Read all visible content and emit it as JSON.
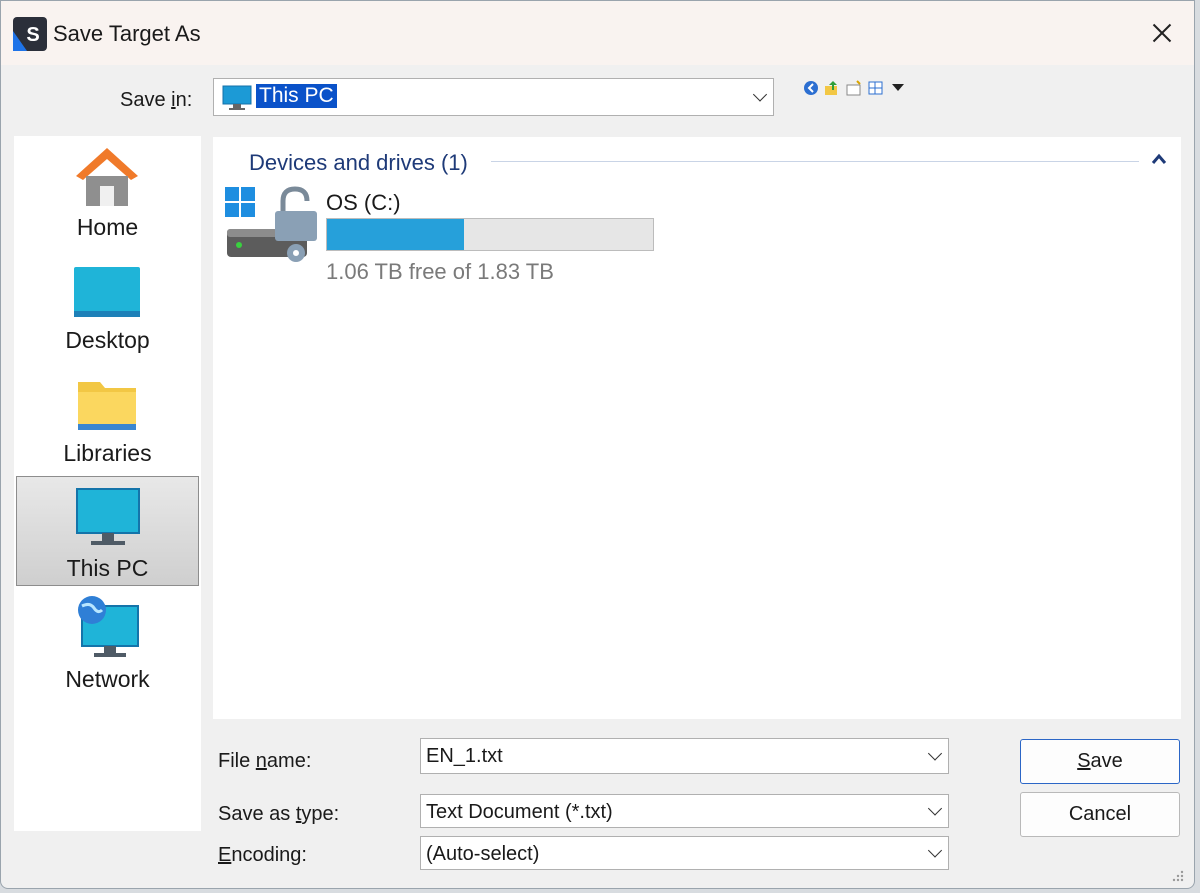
{
  "window": {
    "title": "Save Target As"
  },
  "save_in": {
    "label_pre": "Save ",
    "label_key": "i",
    "label_post": "n:",
    "value": "This PC"
  },
  "places": [
    {
      "label": "Home",
      "icon": "home-icon"
    },
    {
      "label": "Desktop",
      "icon": "desktop-icon"
    },
    {
      "label": "Libraries",
      "icon": "libraries-icon"
    },
    {
      "label": "This PC",
      "icon": "this-pc-icon",
      "selected": true
    },
    {
      "label": "Network",
      "icon": "network-icon"
    }
  ],
  "content": {
    "group_header": "Devices and drives (1)",
    "drive": {
      "name": "OS (C:)",
      "free_text": "1.06 TB free of 1.83 TB",
      "used_fraction": 0.42
    }
  },
  "file_name": {
    "label_pre": "File ",
    "label_key": "n",
    "label_post": "ame:",
    "value": "EN_1.txt"
  },
  "save_as_type": {
    "label_pre": "Save as ",
    "label_key": "t",
    "label_post": "ype:",
    "value": "Text Document (*.txt)"
  },
  "encoding": {
    "label_pre": "",
    "label_key": "E",
    "label_post": "ncoding:",
    "value": "(Auto-select)"
  },
  "buttons": {
    "save_key": "S",
    "save_rest": "ave",
    "cancel": "Cancel"
  },
  "colors": {
    "accent": "#0a52c9",
    "drive_bar": "#26a0da",
    "group_header": "#1e3a78"
  }
}
